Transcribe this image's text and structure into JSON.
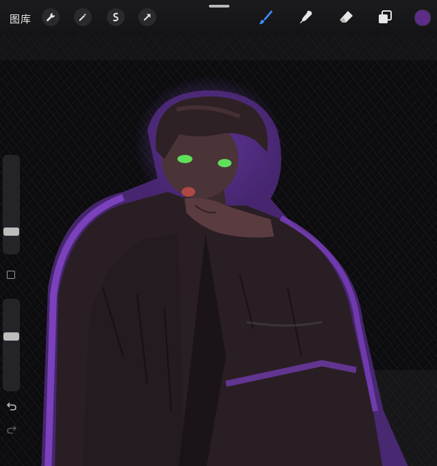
{
  "topbar": {
    "gallery_label": "图库",
    "left_tools": [
      {
        "name": "actions-wrench-icon"
      },
      {
        "name": "adjustments-magic-wand-icon"
      },
      {
        "name": "selection-s-icon"
      },
      {
        "name": "transform-arrow-icon"
      }
    ],
    "right_tools": [
      {
        "name": "brush-icon",
        "active": true
      },
      {
        "name": "smudge-icon"
      },
      {
        "name": "eraser-icon"
      },
      {
        "name": "layers-icon"
      }
    ],
    "current_color": "#5b2d86"
  },
  "sidebar": {
    "brush_size_level": 0.22,
    "opacity_level": 0.66
  },
  "colors": {
    "accent_blue": "#3d8bf3",
    "paint_purple": "#7a3fbf",
    "eye_green": "#5fe05a"
  }
}
